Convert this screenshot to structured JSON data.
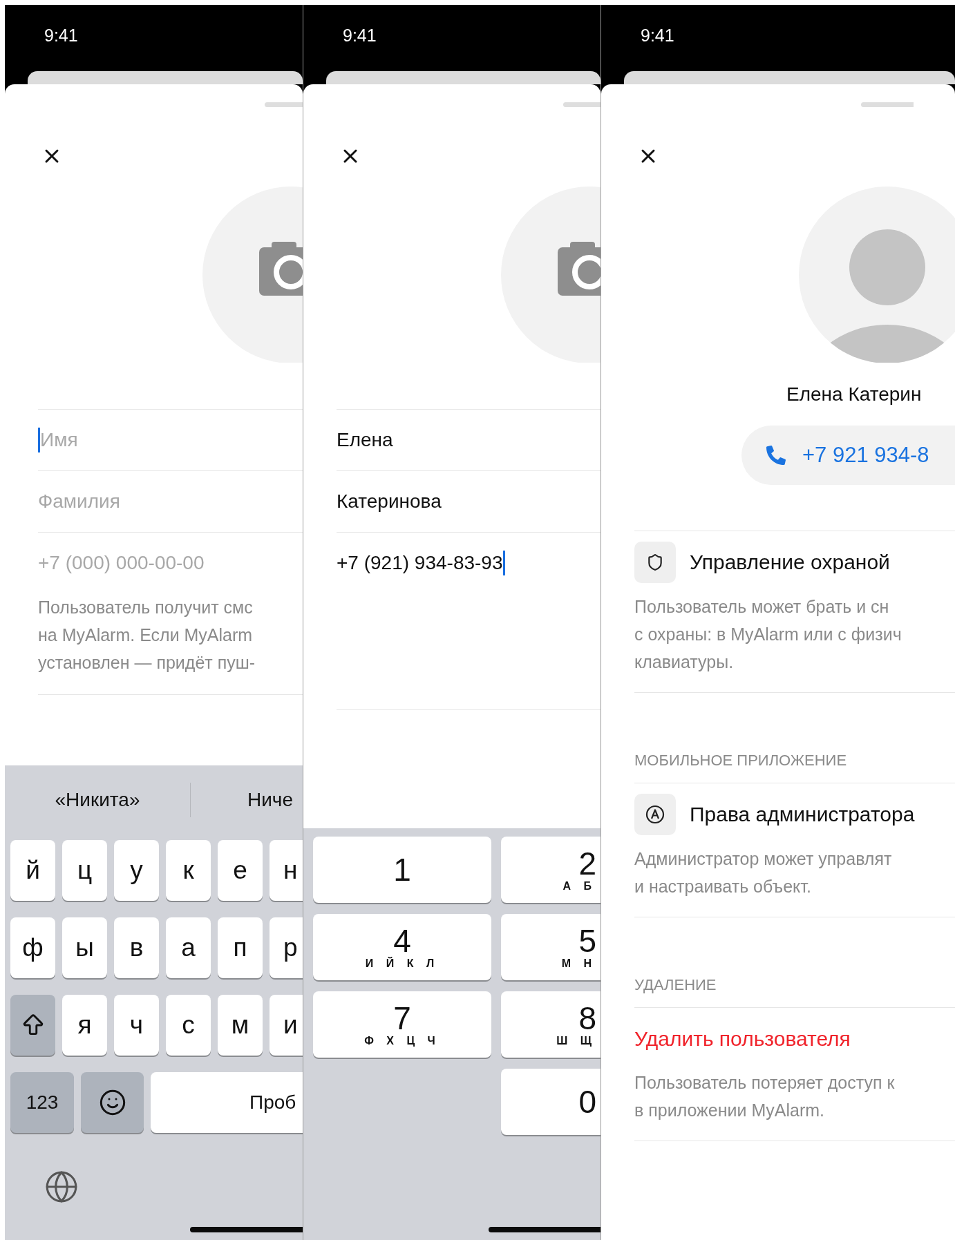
{
  "screens": [
    {
      "kind": "form",
      "status_time": "9:41",
      "fields": [
        {
          "placeholder": "Имя",
          "focused": true
        },
        {
          "placeholder": "Фамилия",
          "focused": false
        },
        {
          "placeholder": "+7 (000) 000-00-00",
          "focused": false
        }
      ],
      "hint": "Пользователь получит смс\nна MyAlarm. Если MyAlarm\nустановлен — придёт пуш-",
      "keyboard": {
        "kind": "letters",
        "suggestions": [
          "«Никита»",
          "Ниче"
        ],
        "rows": [
          [
            {
              "kind": "letter",
              "label": "й"
            },
            {
              "kind": "letter",
              "label": "ц"
            },
            {
              "kind": "letter",
              "label": "у"
            },
            {
              "kind": "letter",
              "label": "к"
            },
            {
              "kind": "letter",
              "label": "е"
            },
            {
              "kind": "letter",
              "label": "н"
            }
          ],
          [
            {
              "kind": "letter",
              "label": "ф"
            },
            {
              "kind": "letter",
              "label": "ы"
            },
            {
              "kind": "letter",
              "label": "в"
            },
            {
              "kind": "letter",
              "label": "а"
            },
            {
              "kind": "letter",
              "label": "п"
            },
            {
              "kind": "letter",
              "label": "р"
            }
          ],
          [
            {
              "kind": "shift"
            },
            {
              "kind": "letter",
              "label": "я"
            },
            {
              "kind": "letter",
              "label": "ч"
            },
            {
              "kind": "letter",
              "label": "с"
            },
            {
              "kind": "letter",
              "label": "м"
            },
            {
              "kind": "letter",
              "label": "и"
            }
          ]
        ],
        "numbers_key": "123",
        "space_key": "Проб"
      }
    },
    {
      "kind": "form",
      "status_time": "9:41",
      "fields": [
        {
          "value": "Елена",
          "focused": false
        },
        {
          "value": "Катеринова",
          "focused": false
        },
        {
          "value": "+7 (921) 934-83-93",
          "focused": true
        }
      ],
      "keyboard": {
        "kind": "numpad",
        "keys": [
          {
            "digit": "1"
          },
          {
            "digit": "2",
            "letters": "А Б"
          },
          {
            "digit": "4",
            "letters": "И Й К Л"
          },
          {
            "digit": "5",
            "letters": "М Н"
          },
          {
            "digit": "7",
            "letters": "Ф Х Ц Ч"
          },
          {
            "digit": "8",
            "letters": "Ш Щ"
          },
          {
            "digit": "0"
          }
        ]
      }
    },
    {
      "kind": "profile",
      "status_time": "9:41",
      "name": "Елена Катерин",
      "phone": "+7 921 934-8",
      "sections": [
        {
          "items": [
            {
              "kind": "security",
              "title": "Управление охраной",
              "description": "Пользователь может брать и сн\nс охраны: в MyAlarm или с физич\nклавиатуры."
            }
          ]
        },
        {
          "header": "МОБИЛЬНОЕ ПРИЛОЖЕНИЕ",
          "items": [
            {
              "kind": "admin",
              "title": "Права администратора",
              "description": "Администратор может управлят\nи настраивать объект."
            }
          ]
        },
        {
          "header": "УДАЛЕНИЕ",
          "items": [
            {
              "kind": "delete",
              "title": "Удалить пользователя",
              "description": "Пользователь потеряет доступ к\nв приложении MyAlarm."
            }
          ]
        }
      ]
    }
  ]
}
